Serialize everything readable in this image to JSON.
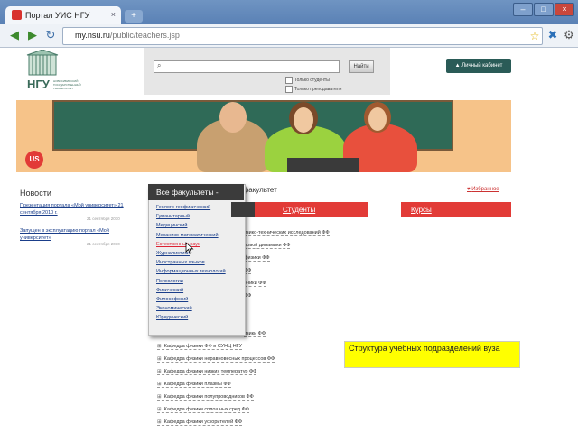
{
  "browser": {
    "tab_title": "Портал УИС НГУ",
    "new_tab": "+",
    "url_host": "my.nsu.ru",
    "url_path": "/public/teachers.jsp",
    "close_tab": "×",
    "win_min": "–",
    "win_max": "□",
    "win_close": "×"
  },
  "header": {
    "logo_text": "НГУ",
    "logo_subtitle": "НОВОСИБИРСКИЙ ГОСУДАРСТВЕННЫЙ УНИВЕРСИТЕТ",
    "search_button": "Найти",
    "option1": "Только студенты",
    "option2": "Только преподаватели",
    "cabinet_button": "▲ Личный кабинет"
  },
  "banner": {
    "badge": "US"
  },
  "news": {
    "title": "Новости",
    "items": [
      {
        "text": "Презентация портала «Мой университет» 21 сентября 2010 г.",
        "date": "21 сентября 2010"
      },
      {
        "text": "Запущен в эксплуатацию портал «Мой университет»",
        "date": "21 сентября 2010"
      }
    ]
  },
  "faculty": {
    "heading": "й факультет",
    "favorites": "Избранное",
    "tabs": [
      "Студенты",
      "Курсы"
    ]
  },
  "departments": [
    {
      "text": "изико-технических исследований ФФ",
      "full": false
    },
    {
      "text": "ловой динамики ФФ",
      "full": false
    },
    {
      "text": "физики ФФ",
      "full": false
    },
    {
      "text": "ФФ",
      "full": false
    },
    {
      "text": "оники ФФ",
      "full": false
    },
    {
      "text": "ФФ",
      "full": false
    },
    {
      "text": "изики ФФ",
      "full": false
    },
    {
      "text": "Кафедра физики ФФ и СУНЦ НГУ",
      "full": true
    },
    {
      "text": "Кафедра физики неравновесных процессов ФФ",
      "full": true
    },
    {
      "text": "Кафедра физики низких температур ФФ",
      "full": true
    },
    {
      "text": "Кафедра физики плазмы ФФ",
      "full": true
    },
    {
      "text": "Кафедра физики полупроводников ФФ",
      "full": true
    },
    {
      "text": "Кафедра физики сплошных сред ФФ",
      "full": true
    },
    {
      "text": "Кафедра физики ускорителей ФФ",
      "full": true
    }
  ],
  "dropdown": {
    "title": "Все факультеты -",
    "items": [
      "Геолого-геофизический",
      "Гуманитарный",
      "Медицинский",
      "Механико-математический",
      "Естественных наук",
      "Журналистики",
      "Иностранных языков",
      "Информационных технологий",
      "Психологии",
      "Физический",
      "Философский",
      "Экономический",
      "Юридический"
    ],
    "active_index": 4
  },
  "callout": {
    "text": "Структура учебных подразделений вуза"
  },
  "colors": {
    "accent_red": "#e23b37",
    "dark_teal": "#2a5b57",
    "browser_blue": "#5a81b5"
  }
}
